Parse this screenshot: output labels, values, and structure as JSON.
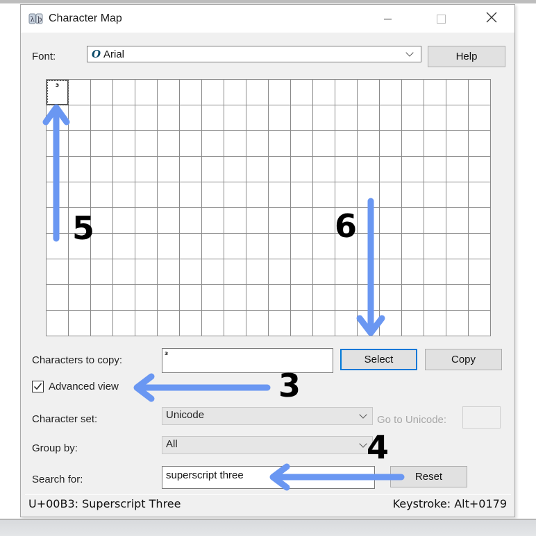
{
  "window": {
    "title": "Character Map",
    "app_icon": "character-map-icon",
    "controls": {
      "minimize": "minimize-icon",
      "maximize": "maximize-icon",
      "close": "close-icon"
    }
  },
  "font": {
    "label": "Font:",
    "value": "Arial",
    "font_type_glyph": "O",
    "help_label": "Help"
  },
  "grid": {
    "columns": 20,
    "rows": 10,
    "cells": [
      "³"
    ],
    "selected_index": 0
  },
  "copy": {
    "label": "Characters to copy:",
    "value": "³",
    "select_label": "Select",
    "copy_label": "Copy"
  },
  "advanced": {
    "label": "Advanced view",
    "checked": true
  },
  "charset": {
    "label": "Character set:",
    "value": "Unicode",
    "goto_label": "Go to Unicode:",
    "goto_value": ""
  },
  "groupby": {
    "label": "Group by:",
    "value": "All"
  },
  "search": {
    "label": "Search for:",
    "value": "superscript three",
    "reset_label": "Reset"
  },
  "status": {
    "char_info": "U+00B3: Superscript Three",
    "keystroke": "Keystroke: Alt+0179"
  },
  "annotations": {
    "color": "#6a97f2",
    "steps": [
      {
        "number": "3",
        "target": "Advanced view checkbox"
      },
      {
        "number": "4",
        "target": "Search for field"
      },
      {
        "number": "5",
        "target": "Selected character cell"
      },
      {
        "number": "6",
        "target": "Select button"
      }
    ]
  }
}
